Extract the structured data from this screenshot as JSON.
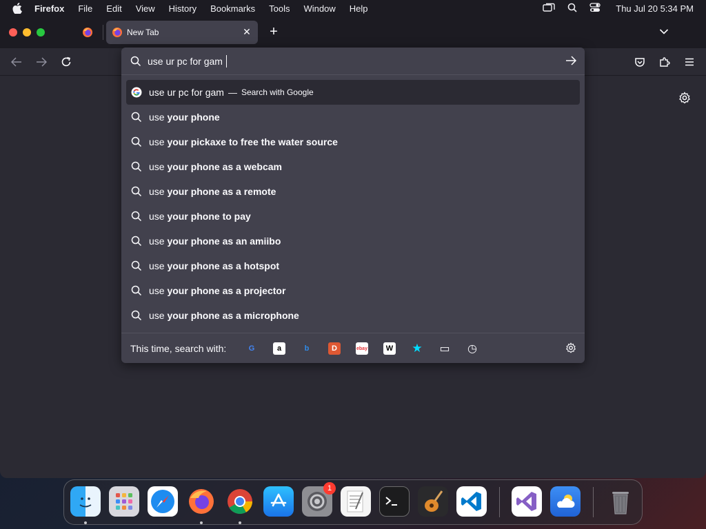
{
  "menubar": {
    "app_name": "Firefox",
    "items": [
      "File",
      "Edit",
      "View",
      "History",
      "Bookmarks",
      "Tools",
      "Window",
      "Help"
    ],
    "clock": "Thu Jul 20  5:34 PM"
  },
  "tabs": {
    "active_title": "New Tab",
    "close_glyph": "✕",
    "new_tab_glyph": "+"
  },
  "urlbar": {
    "value": "use ur pc for gam",
    "first_result": {
      "text": "use ur pc for gam",
      "separator": "—",
      "action": "Search with Google"
    },
    "suggestions": [
      {
        "typed": "use",
        "rest": " your phone"
      },
      {
        "typed": "use",
        "rest": " your pickaxe to free the water source"
      },
      {
        "typed": "use",
        "rest": " your phone as a webcam"
      },
      {
        "typed": "use",
        "rest": " your phone as a remote"
      },
      {
        "typed": "use",
        "rest": " your phone to pay"
      },
      {
        "typed": "use",
        "rest": " your phone as an amiibo"
      },
      {
        "typed": "use",
        "rest": " your phone as a hotspot"
      },
      {
        "typed": "use",
        "rest": " your phone as a projector"
      },
      {
        "typed": "use",
        "rest": " your phone as a microphone"
      }
    ],
    "oneoff_label": "This time, search with:",
    "engines": [
      {
        "name": "google-icon",
        "glyph": "G",
        "color": "#4285f4",
        "bg": "transparent"
      },
      {
        "name": "amazon-icon",
        "glyph": "a",
        "color": "#000000",
        "bg": "#ffffff"
      },
      {
        "name": "bing-icon",
        "glyph": "b",
        "color": "#2f8be8",
        "bg": "transparent"
      },
      {
        "name": "duckduckgo-icon",
        "glyph": "D",
        "color": "#ffffff",
        "bg": "#de5833"
      },
      {
        "name": "ebay-icon",
        "glyph": "ebay",
        "color": "#e53238",
        "bg": "#ffffff"
      },
      {
        "name": "wikipedia-icon",
        "glyph": "W",
        "color": "#000000",
        "bg": "#ffffff"
      },
      {
        "name": "bookmarks-star-icon",
        "glyph": "★",
        "color": "#00ddff",
        "bg": "transparent"
      },
      {
        "name": "tabs-icon",
        "glyph": "▭",
        "color": "#fbfbfe",
        "bg": "transparent"
      },
      {
        "name": "history-clock-icon",
        "glyph": "◷",
        "color": "#fbfbfe",
        "bg": "transparent"
      }
    ]
  },
  "dock": {
    "apps": [
      "Finder",
      "Launchpad",
      "Safari",
      "Firefox",
      "Google Chrome",
      "App Store",
      "System Settings",
      "TextEdit",
      "Terminal",
      "GarageBand",
      "Visual Studio Code",
      "Visual Studio",
      "Weather",
      "Trash"
    ],
    "settings_badge": "1"
  }
}
